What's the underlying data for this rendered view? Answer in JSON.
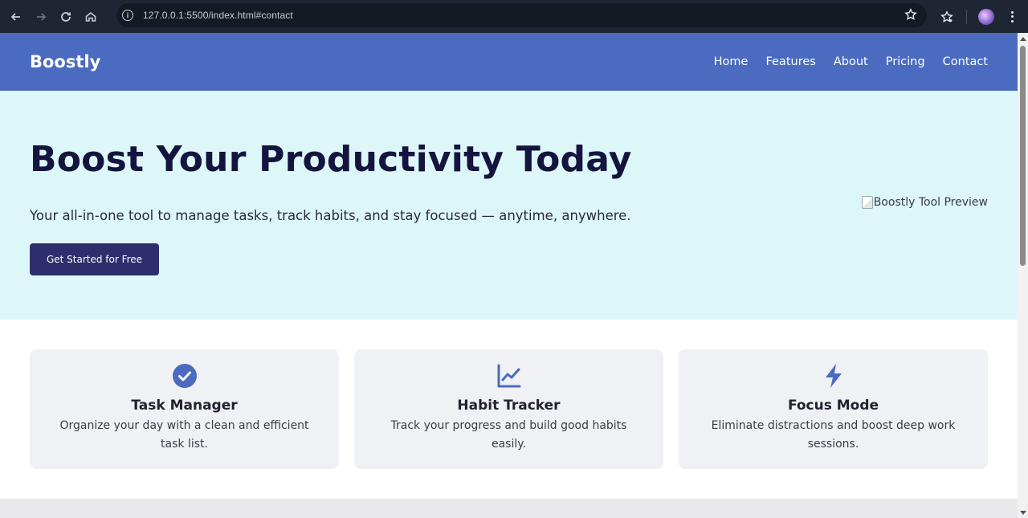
{
  "browser": {
    "url": "127.0.0.1:5500/index.html#contact"
  },
  "site": {
    "logo": "Boostly",
    "nav": [
      "Home",
      "Features",
      "About",
      "Pricing",
      "Contact"
    ]
  },
  "hero": {
    "title": "Boost Your Productivity Today",
    "subtitle": "Your all-in-one tool to manage tasks, track habits, and stay focused — anytime, anywhere.",
    "cta_label": "Get Started for Free",
    "image_alt": "Boostly Tool Preview"
  },
  "features": [
    {
      "icon": "check-circle-icon",
      "title": "Task Manager",
      "description": "Organize your day with a clean and efficient task list."
    },
    {
      "icon": "chart-line-icon",
      "title": "Habit Tracker",
      "description": "Track your progress and build good habits easily."
    },
    {
      "icon": "bolt-icon",
      "title": "Focus Mode",
      "description": "Eliminate distractions and boost deep work sessions."
    }
  ],
  "colors": {
    "header": "#4a6bbf",
    "hero_bg": "#ddf7f8",
    "cta": "#2d2e6b",
    "card_bg": "#f0f1f5"
  }
}
